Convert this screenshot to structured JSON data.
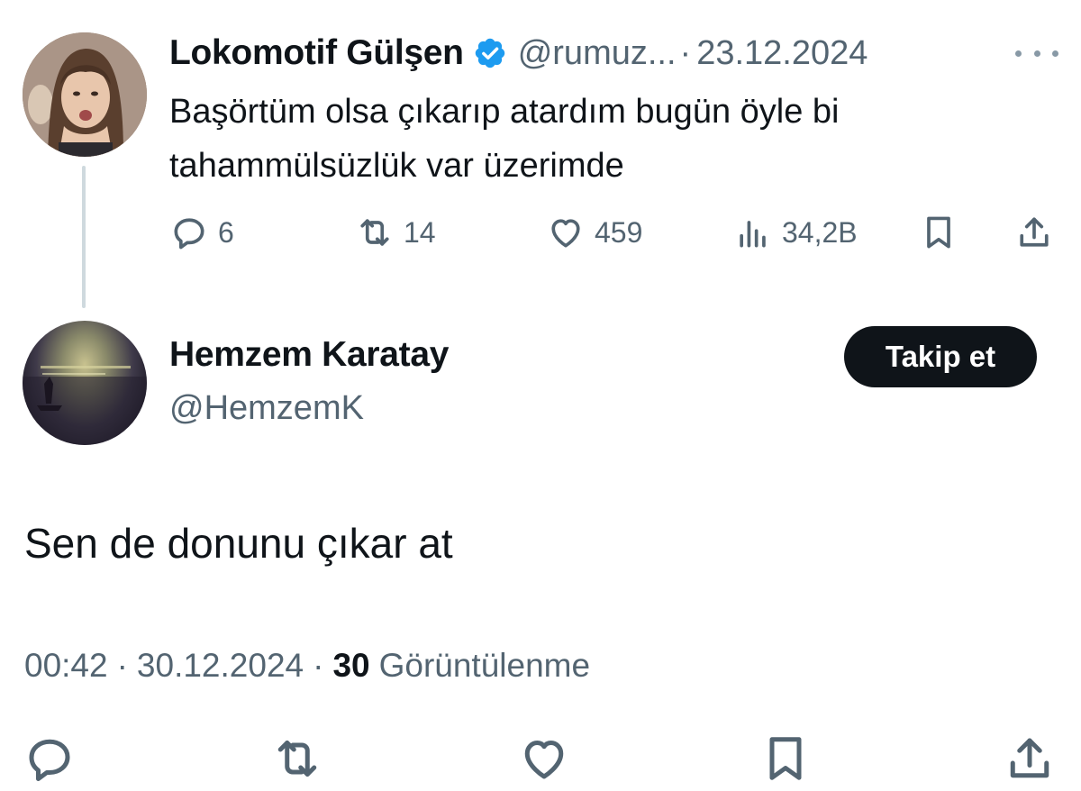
{
  "parent": {
    "display_name": "Lokomotif Gülşen",
    "handle": "@rumuz...",
    "separator": "·",
    "date": "23.12.2024",
    "text": "Başörtüm olsa çıkarıp atardım bugün öyle bi tahammülsüzlük var üzerimde",
    "metrics": {
      "replies": "6",
      "retweets": "14",
      "likes": "459",
      "views": "34,2B"
    },
    "icons": {
      "verified": "verified-badge-icon",
      "more": "more-dots-icon",
      "reply": "reply-icon",
      "retweet": "retweet-icon",
      "like": "heart-icon",
      "views": "views-chart-icon",
      "bookmark": "bookmark-icon",
      "share": "share-icon"
    }
  },
  "reply": {
    "display_name": "Hemzem Karatay",
    "handle": "@HemzemK",
    "follow_label": "Takip et",
    "text": "Sen de donunu çıkar at",
    "time": "00:42",
    "separator": "·",
    "date": "30.12.2024",
    "views_count": "30",
    "views_label": "Görüntülenme"
  },
  "colors": {
    "text_primary": "#0f1419",
    "text_secondary": "#536471",
    "verified_blue": "#1d9bf0",
    "thread_line": "#cfd9de",
    "follow_button_bg": "#0f1419"
  }
}
